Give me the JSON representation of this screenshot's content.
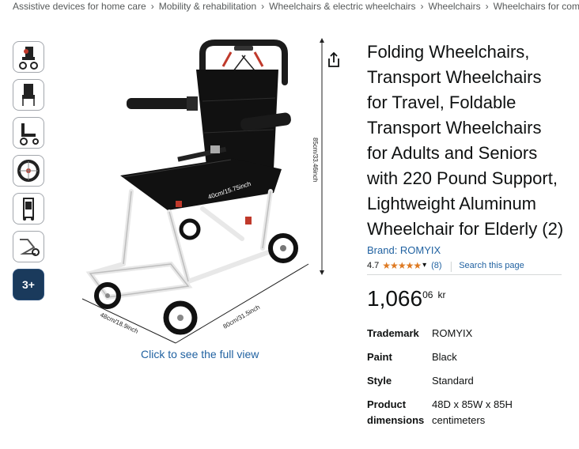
{
  "breadcrumb": [
    "Assistive devices for home care",
    "Mobility & rehabilitation",
    "Wheelchairs & electric wheelchairs",
    "Wheelchairs",
    "Wheelchairs for com"
  ],
  "breadcrumb_sep": "›",
  "thumbnails": {
    "more_label": "3+"
  },
  "image": {
    "dim_height": "85cm/33.46inch",
    "dim_seat": "40cm/15.75inch",
    "dim_depth": "48cm/18.9inch",
    "dim_length": "80cm/31.5inch",
    "full_view_label": "Click to see the full view"
  },
  "product": {
    "title": "Folding Wheelchairs, Transport Wheelchairs for Travel, Foldable Transport Wheelchairs for Adults and Seniors with 220 Pound Support, Lightweight Aluminum Wheelchair for Elderly (2)",
    "brand": "Brand: ROMYIX",
    "rating": "4.7",
    "stars": "★★★★★",
    "review_count": "(8)",
    "search_link": "Search this page",
    "price_whole": "1,066",
    "price_fraction": "06",
    "price_currency": "kr",
    "specs": [
      {
        "label": "Trademark",
        "value": "ROMYIX"
      },
      {
        "label": "Paint",
        "value": "Black"
      },
      {
        "label": "Style",
        "value": "Standard"
      },
      {
        "label": "Product dimensions",
        "value": "48D x 85W x 85H centimeters"
      }
    ]
  },
  "colors": {
    "link": "#2162a1",
    "star": "#de7921",
    "text": "#0f1111",
    "muted": "#565959"
  }
}
